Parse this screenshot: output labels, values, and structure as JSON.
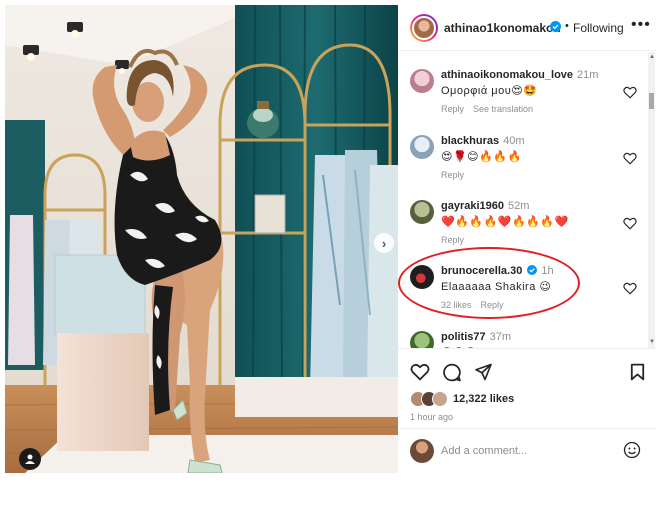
{
  "post": {
    "author": "athinao1konomakou",
    "verified": true,
    "follow_status": "Following",
    "separator": "•",
    "more_label": "•••"
  },
  "comments": [
    {
      "user": "athinaoikonomakou_love",
      "verified": false,
      "time": "21m",
      "text": "Ομορφιά μου😍🤩",
      "actions": [
        "Reply",
        "See translation"
      ],
      "avatar_color": "#c9a1a8"
    },
    {
      "user": "blackhuras",
      "verified": false,
      "time": "40m",
      "text": "😍🌹😊🔥🔥🔥",
      "actions": [
        "Reply"
      ],
      "avatar_color": "#a7b8c9"
    },
    {
      "user": "gayraki1960",
      "verified": false,
      "time": "52m",
      "text": "❤️🔥🔥🔥❤️🔥🔥🔥❤️",
      "actions": [
        "Reply"
      ],
      "avatar_color": "#6f7a55"
    },
    {
      "user": "brunocerella.30",
      "verified": true,
      "time": "1h",
      "text": "Elaaaaaa Shakira 😉",
      "actions": [
        "32 likes",
        "Reply"
      ],
      "avatar_color": "#1e1e1e"
    },
    {
      "user": "politis77",
      "verified": false,
      "time": "37m",
      "text": "😍😍😍",
      "actions": [],
      "avatar_color": "#5d8a4a"
    }
  ],
  "engagement": {
    "likes_count": "12,322",
    "likes_label": "likes",
    "posted": "1 hour ago"
  },
  "add_comment": {
    "placeholder": "Add a comment..."
  },
  "colors": {
    "accent": "#0095f6",
    "highlight": "#e02020",
    "muted": "#8e8e8e"
  },
  "icons": [
    "heart-icon",
    "comment-icon",
    "share-icon",
    "bookmark-icon",
    "emoji-icon",
    "chevron-right-icon",
    "user-tag-icon",
    "verified-icon"
  ]
}
